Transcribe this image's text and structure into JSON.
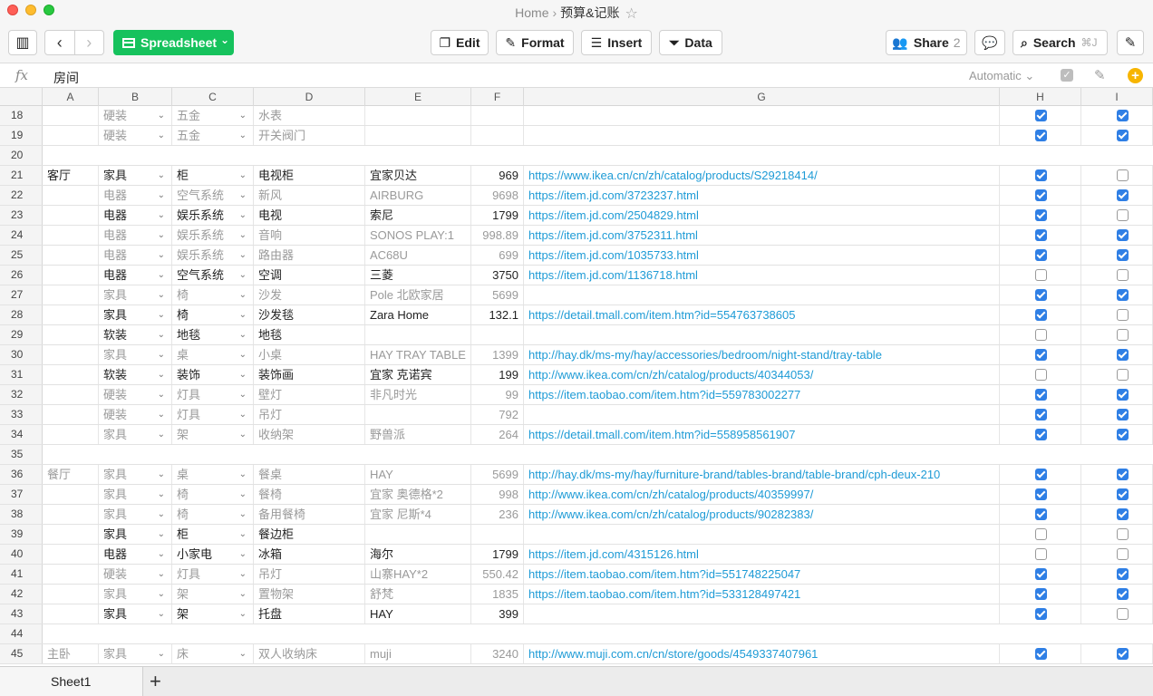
{
  "window": {
    "breadcrumb_home": "Home",
    "breadcrumb_sep": "›",
    "doc_title": "预算&记账",
    "star": "☆"
  },
  "toolbar": {
    "sidebar_icon": "▥",
    "back": "‹",
    "forward": "›",
    "sheet_label": "Spreadsheet",
    "sheet_caret": "⌄",
    "edit": "Edit",
    "format": "Format",
    "insert": "Insert",
    "data": "Data",
    "share": "Share",
    "share_count": "2",
    "search": "Search",
    "search_kbd": "⌘J",
    "comment_icon": "chat-bubbles-icon",
    "compose_icon": "compose-icon"
  },
  "formula_bar": {
    "fx": "fx",
    "value": "房间",
    "mode": "Automatic ⌄",
    "plus": "+"
  },
  "columns": [
    "A",
    "B",
    "C",
    "D",
    "E",
    "F",
    "G",
    "H",
    "I"
  ],
  "rows": [
    {
      "n": "18",
      "dim": true,
      "a": "",
      "b": "硬装",
      "c": "五金",
      "d": "水表",
      "e": "",
      "f": "",
      "g": "",
      "h": true,
      "i": true
    },
    {
      "n": "19",
      "dim": true,
      "a": "",
      "b": "硬装",
      "c": "五金",
      "d": "开关阀门",
      "e": "",
      "f": "",
      "g": "",
      "h": true,
      "i": true
    },
    {
      "n": "20",
      "empty": true
    },
    {
      "n": "21",
      "dim": false,
      "a": "客厅",
      "b": "家具",
      "c": "柜",
      "d": "电视柜",
      "e": "宜家贝达",
      "f": "969",
      "g": "https://www.ikea.cn/cn/zh/catalog/products/S29218414/",
      "h": true,
      "i": false
    },
    {
      "n": "22",
      "dim": true,
      "a": "",
      "b": "电器",
      "c": "空气系统",
      "d": "新风",
      "e": "AIRBURG",
      "f": "9698",
      "g": "https://item.jd.com/3723237.html",
      "h": true,
      "i": true
    },
    {
      "n": "23",
      "dim": false,
      "a": "",
      "b": "电器",
      "c": "娱乐系统",
      "d": "电视",
      "e": "索尼",
      "f": "1799",
      "g": "https://item.jd.com/2504829.html",
      "h": true,
      "i": false
    },
    {
      "n": "24",
      "dim": true,
      "a": "",
      "b": "电器",
      "c": "娱乐系统",
      "d": "音响",
      "e": "SONOS PLAY:1",
      "f": "998.89",
      "g": "https://item.jd.com/3752311.html",
      "h": true,
      "i": true
    },
    {
      "n": "25",
      "dim": true,
      "a": "",
      "b": "电器",
      "c": "娱乐系统",
      "d": "路由器",
      "e": "AC68U",
      "f": "699",
      "g": "https://item.jd.com/1035733.html",
      "h": true,
      "i": true
    },
    {
      "n": "26",
      "dim": false,
      "a": "",
      "b": "电器",
      "c": "空气系统",
      "d": "空调",
      "e": "三菱",
      "f": "3750",
      "g": "https://item.jd.com/1136718.html",
      "h": false,
      "i": false
    },
    {
      "n": "27",
      "dim": true,
      "a": "",
      "b": "家具",
      "c": "椅",
      "d": "沙发",
      "e": "Pole 北欧家居",
      "f": "5699",
      "g": "",
      "h": true,
      "i": true
    },
    {
      "n": "28",
      "dim": false,
      "a": "",
      "b": "家具",
      "c": "椅",
      "d": "沙发毯",
      "e": "Zara Home",
      "f": "132.1",
      "g": "https://detail.tmall.com/item.htm?id=554763738605",
      "h": true,
      "i": false
    },
    {
      "n": "29",
      "dim": false,
      "a": "",
      "b": "软装",
      "c": "地毯",
      "d": "地毯",
      "e": "",
      "f": "",
      "g": "",
      "h": false,
      "i": false
    },
    {
      "n": "30",
      "dim": true,
      "a": "",
      "b": "家具",
      "c": "桌",
      "d": "小桌",
      "e": "HAY TRAY TABLE",
      "f": "1399",
      "g": "http://hay.dk/ms-my/hay/accessories/bedroom/night-stand/tray-table",
      "h": true,
      "i": true
    },
    {
      "n": "31",
      "dim": false,
      "a": "",
      "b": "软装",
      "c": "装饰",
      "d": "装饰画",
      "e": "宜家 克诺宾",
      "f": "199",
      "g": "http://www.ikea.com/cn/zh/catalog/products/40344053/",
      "h": false,
      "i": false
    },
    {
      "n": "32",
      "dim": true,
      "a": "",
      "b": "硬装",
      "c": "灯具",
      "d": "壁灯",
      "e": "非凡时光",
      "f": "99",
      "g": "https://item.taobao.com/item.htm?id=559783002277",
      "h": true,
      "i": true
    },
    {
      "n": "33",
      "dim": true,
      "a": "",
      "b": "硬装",
      "c": "灯具",
      "d": "吊灯",
      "e": "",
      "f": "792",
      "g": "",
      "h": true,
      "i": true
    },
    {
      "n": "34",
      "dim": true,
      "a": "",
      "b": "家具",
      "c": "架",
      "d": "收纳架",
      "e": "野兽派",
      "f": "264",
      "g": "https://detail.tmall.com/item.htm?id=558958561907",
      "h": true,
      "i": true
    },
    {
      "n": "35",
      "empty": true
    },
    {
      "n": "36",
      "dim": true,
      "a": "餐厅",
      "b": "家具",
      "c": "桌",
      "d": "餐桌",
      "e": "HAY",
      "f": "5699",
      "g": "http://hay.dk/ms-my/hay/furniture-brand/tables-brand/table-brand/cph-deux-210",
      "h": true,
      "i": true
    },
    {
      "n": "37",
      "dim": true,
      "a": "",
      "b": "家具",
      "c": "椅",
      "d": "餐椅",
      "e": "宜家 奥德格*2",
      "f": "998",
      "g": "http://www.ikea.com/cn/zh/catalog/products/40359997/",
      "h": true,
      "i": true
    },
    {
      "n": "38",
      "dim": true,
      "a": "",
      "b": "家具",
      "c": "椅",
      "d": "备用餐椅",
      "e": "宜家 尼斯*4",
      "f": "236",
      "g": "http://www.ikea.com/cn/zh/catalog/products/90282383/",
      "h": true,
      "i": true
    },
    {
      "n": "39",
      "dim": false,
      "a": "",
      "b": "家具",
      "c": "柜",
      "d": "餐边柜",
      "e": "",
      "f": "",
      "g": "",
      "h": false,
      "i": false
    },
    {
      "n": "40",
      "dim": false,
      "a": "",
      "b": "电器",
      "c": "小家电",
      "d": "冰箱",
      "e": "海尔",
      "f": "1799",
      "g": "https://item.jd.com/4315126.html",
      "h": false,
      "i": false
    },
    {
      "n": "41",
      "dim": true,
      "a": "",
      "b": "硬装",
      "c": "灯具",
      "d": "吊灯",
      "e": "山寨HAY*2",
      "f": "550.42",
      "g": "https://item.taobao.com/item.htm?id=551748225047",
      "h": true,
      "i": true
    },
    {
      "n": "42",
      "dim": true,
      "a": "",
      "b": "家具",
      "c": "架",
      "d": "置物架",
      "e": "舒梵",
      "f": "1835",
      "g": "https://item.taobao.com/item.htm?id=533128497421",
      "h": true,
      "i": true
    },
    {
      "n": "43",
      "dim": false,
      "a": "",
      "b": "家具",
      "c": "架",
      "d": "托盘",
      "e": "HAY",
      "f": "399",
      "g": "",
      "h": true,
      "i": false
    },
    {
      "n": "44",
      "empty": true
    },
    {
      "n": "45",
      "dim": true,
      "a": "主卧",
      "b": "家具",
      "c": "床",
      "d": "双人收纳床",
      "e": "muji",
      "f": "3240",
      "g": "http://www.muji.com.cn/cn/store/goods/4549337407961",
      "h": true,
      "i": true
    }
  ],
  "tabs": {
    "sheet1": "Sheet1",
    "add": "+"
  },
  "colors": {
    "accent_green": "#16c25d",
    "link": "#1e9bd6",
    "checkbox": "#2f7fe5"
  }
}
